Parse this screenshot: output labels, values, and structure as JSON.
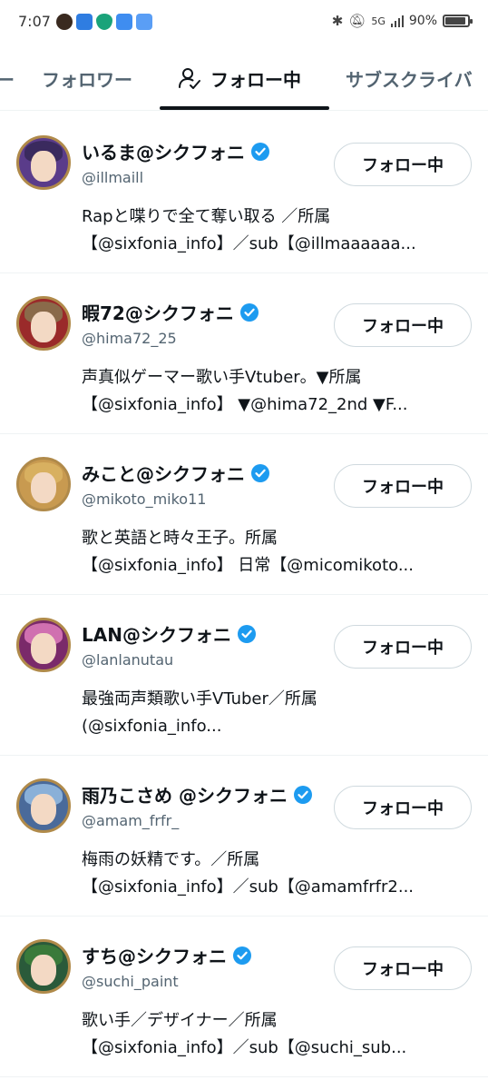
{
  "status_bar": {
    "time": "7:07",
    "network": "5G",
    "battery_text": "90%",
    "battery_level": 0.9,
    "left_icons": [
      "app-icon-a",
      "video-app-icon",
      "shield-app-icon",
      "cloud-app-icon",
      "calendar-app-icon"
    ],
    "right_icons": [
      "bluetooth-icon",
      "mute-icon",
      "signal-icon",
      "battery-icon"
    ]
  },
  "tabs": {
    "items": [
      {
        "label": "ー"
      },
      {
        "label": "フォロワー"
      },
      {
        "label": "フォロー中",
        "active": true,
        "icon": "person-check-icon"
      },
      {
        "label": "サブスクライバ"
      }
    ]
  },
  "colors": {
    "accent": "#1d9bf0",
    "text": "#0f1419",
    "secondary_text": "#536471",
    "border": "#cfd9de"
  },
  "users": [
    {
      "name": "いるま@シクフォニ",
      "handle": "@illmaill",
      "bio_lines": [
        "Rapと喋りで全て奪い取る ／所属",
        "【@sixfonia_info】／sub【@illmaaaaaa..."
      ],
      "button": "フォロー中",
      "avatar_hair": "#3a2a5e",
      "avatar_bg": "#5a3c8a"
    },
    {
      "name": "暇72@シクフォニ",
      "handle": "@hima72_25",
      "bio_lines": [
        "声真似ゲーマー歌い手Vtuber。▼所属",
        "【@sixfonia_info】 ▼@hima72_2nd ▼F..."
      ],
      "button": "フォロー中",
      "avatar_hair": "#8a6a4a",
      "avatar_bg": "#9a2a2a"
    },
    {
      "name": "みこと@シクフォニ",
      "handle": "@mikoto_miko11",
      "bio_lines": [
        "歌と英語と時々王子。所属",
        "【@sixfonia_info】 日常【@micomikoto..."
      ],
      "button": "フォロー中",
      "avatar_hair": "#d8b060",
      "avatar_bg": "#c89a50"
    },
    {
      "name": "LAN@シクフォニ",
      "handle": "@lanlanutau",
      "bio_lines": [
        "最強両声類歌い手VTuber／所属",
        "(@sixfonia_info..."
      ],
      "button": "フォロー中",
      "avatar_hair": "#d070b0",
      "avatar_bg": "#7a2a6a"
    },
    {
      "name": "雨乃こさめ @シクフォニ",
      "handle": "@amam_frfr_",
      "bio_lines": [
        "梅雨の妖精です。／所属",
        "【@sixfonia_info】／sub【@amamfrfr2..."
      ],
      "button": "フォロー中",
      "avatar_hair": "#8ab0d8",
      "avatar_bg": "#4a6a9a"
    },
    {
      "name": "すち@シクフォニ",
      "handle": "@suchi_paint",
      "bio_lines": [
        "歌い手／デザイナー／所属",
        "【@sixfonia_info】／sub【@suchi_sub..."
      ],
      "button": "フォロー中",
      "avatar_hair": "#3a7a3a",
      "avatar_bg": "#2a5a3a"
    }
  ]
}
